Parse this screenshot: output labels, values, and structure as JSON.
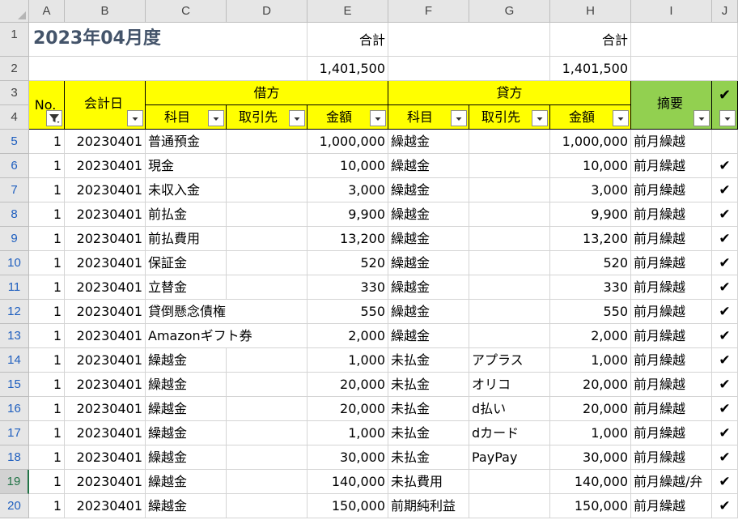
{
  "columns": [
    "A",
    "B",
    "C",
    "D",
    "E",
    "F",
    "G",
    "H",
    "I",
    "J"
  ],
  "rows": [
    "1",
    "2",
    "3",
    "4",
    "5",
    "6",
    "7",
    "8",
    "9",
    "10",
    "11",
    "12",
    "13",
    "14",
    "15",
    "16",
    "17",
    "18",
    "19",
    "20"
  ],
  "title": "2023年04月度",
  "totals": {
    "label": "合計",
    "debit_total": "1,401,500",
    "credit_total": "1,401,500"
  },
  "headers": {
    "no": "No.",
    "date": "会計日",
    "debit": "借方",
    "credit": "貸方",
    "account": "科目",
    "partner": "取引先",
    "amount": "金額",
    "memo": "摘要",
    "check": "✔"
  },
  "entries": [
    {
      "no": "1",
      "date": "20230401",
      "debit_account": "普通預金",
      "debit_partner": "",
      "debit_amount": "1,000,000",
      "credit_account": "繰越金",
      "credit_partner": "",
      "credit_amount": "1,000,000",
      "memo": "前月繰越",
      "check": ""
    },
    {
      "no": "1",
      "date": "20230401",
      "debit_account": "現金",
      "debit_partner": "",
      "debit_amount": "10,000",
      "credit_account": "繰越金",
      "credit_partner": "",
      "credit_amount": "10,000",
      "memo": "前月繰越",
      "check": "✔"
    },
    {
      "no": "1",
      "date": "20230401",
      "debit_account": "未収入金",
      "debit_partner": "",
      "debit_amount": "3,000",
      "credit_account": "繰越金",
      "credit_partner": "",
      "credit_amount": "3,000",
      "memo": "前月繰越",
      "check": "✔"
    },
    {
      "no": "1",
      "date": "20230401",
      "debit_account": "前払金",
      "debit_partner": "",
      "debit_amount": "9,900",
      "credit_account": "繰越金",
      "credit_partner": "",
      "credit_amount": "9,900",
      "memo": "前月繰越",
      "check": "✔"
    },
    {
      "no": "1",
      "date": "20230401",
      "debit_account": "前払費用",
      "debit_partner": "",
      "debit_amount": "13,200",
      "credit_account": "繰越金",
      "credit_partner": "",
      "credit_amount": "13,200",
      "memo": "前月繰越",
      "check": "✔"
    },
    {
      "no": "1",
      "date": "20230401",
      "debit_account": "保証金",
      "debit_partner": "",
      "debit_amount": "520",
      "credit_account": "繰越金",
      "credit_partner": "",
      "credit_amount": "520",
      "memo": "前月繰越",
      "check": "✔"
    },
    {
      "no": "1",
      "date": "20230401",
      "debit_account": "立替金",
      "debit_partner": "",
      "debit_amount": "330",
      "credit_account": "繰越金",
      "credit_partner": "",
      "credit_amount": "330",
      "memo": "前月繰越",
      "check": "✔"
    },
    {
      "no": "1",
      "date": "20230401",
      "debit_account": "貸倒懸念債権",
      "debit_partner": "",
      "debit_amount": "550",
      "credit_account": "繰越金",
      "credit_partner": "",
      "credit_amount": "550",
      "memo": "前月繰越",
      "check": "✔"
    },
    {
      "no": "1",
      "date": "20230401",
      "debit_account": "Amazonギフト券",
      "debit_partner": "",
      "debit_amount": "2,000",
      "credit_account": "繰越金",
      "credit_partner": "",
      "credit_amount": "2,000",
      "memo": "前月繰越",
      "check": "✔"
    },
    {
      "no": "1",
      "date": "20230401",
      "debit_account": "繰越金",
      "debit_partner": "",
      "debit_amount": "1,000",
      "credit_account": "未払金",
      "credit_partner": "アプラス",
      "credit_amount": "1,000",
      "memo": "前月繰越",
      "check": "✔"
    },
    {
      "no": "1",
      "date": "20230401",
      "debit_account": "繰越金",
      "debit_partner": "",
      "debit_amount": "20,000",
      "credit_account": "未払金",
      "credit_partner": "オリコ",
      "credit_amount": "20,000",
      "memo": "前月繰越",
      "check": "✔"
    },
    {
      "no": "1",
      "date": "20230401",
      "debit_account": "繰越金",
      "debit_partner": "",
      "debit_amount": "20,000",
      "credit_account": "未払金",
      "credit_partner": "d払い",
      "credit_amount": "20,000",
      "memo": "前月繰越",
      "check": "✔"
    },
    {
      "no": "1",
      "date": "20230401",
      "debit_account": "繰越金",
      "debit_partner": "",
      "debit_amount": "1,000",
      "credit_account": "未払金",
      "credit_partner": "dカード",
      "credit_amount": "1,000",
      "memo": "前月繰越",
      "check": "✔"
    },
    {
      "no": "1",
      "date": "20230401",
      "debit_account": "繰越金",
      "debit_partner": "",
      "debit_amount": "30,000",
      "credit_account": "未払金",
      "credit_partner": "PayPay",
      "credit_amount": "30,000",
      "memo": "前月繰越",
      "check": "✔"
    },
    {
      "no": "1",
      "date": "20230401",
      "debit_account": "繰越金",
      "debit_partner": "",
      "debit_amount": "140,000",
      "credit_account": "未払費用",
      "credit_partner": "",
      "credit_amount": "140,000",
      "memo": "前月繰越/弁",
      "check": "✔"
    },
    {
      "no": "1",
      "date": "20230401",
      "debit_account": "繰越金",
      "debit_partner": "",
      "debit_amount": "150,000",
      "credit_account": "前期純利益",
      "credit_partner": "",
      "credit_amount": "150,000",
      "memo": "前月繰越",
      "check": "✔"
    }
  ],
  "colors": {
    "header_yellow": "#ffff00",
    "header_green": "#92d050",
    "title_text": "#44546a",
    "active_row": "#217346"
  },
  "icons": {
    "filter_button": "dropdown-arrow-icon",
    "active_filter": "filter-funnel-icon"
  }
}
